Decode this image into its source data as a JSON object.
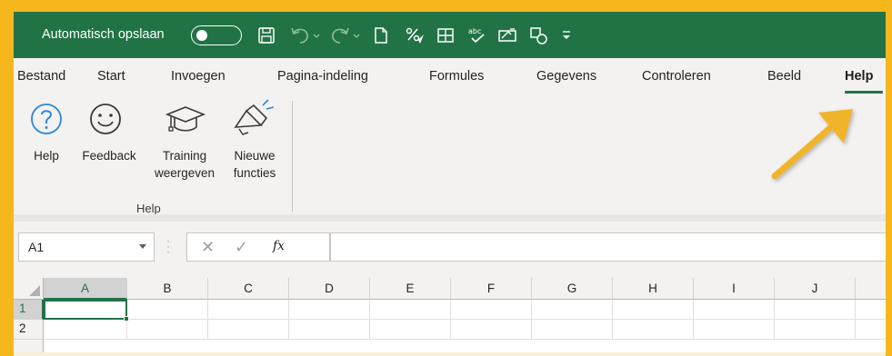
{
  "titlebar": {
    "autosave_label": "Automatisch opslaan",
    "autosave_state": "off",
    "quick_access_icons": [
      "save-icon",
      "undo-icon",
      "redo-icon",
      "new-document-icon",
      "percent-format-icon",
      "table-icon",
      "spelling-icon",
      "data-validation-icon",
      "shapes-icon",
      "customize-menu-icon"
    ]
  },
  "ribbon_tabs": [
    "Bestand",
    "Start",
    "Invoegen",
    "Pagina-indeling",
    "Formules",
    "Gegevens",
    "Controleren",
    "Beeld",
    "Help"
  ],
  "active_tab": "Help",
  "help_group": {
    "label": "Help",
    "buttons": [
      {
        "line1": "Help",
        "line2": "",
        "icon": "question-icon"
      },
      {
        "line1": "Feedback",
        "line2": "",
        "icon": "smiley-icon"
      },
      {
        "line1": "Training",
        "line2": "weergeven",
        "icon": "graduation-cap-icon"
      },
      {
        "line1": "Nieuwe",
        "line2": "functies",
        "icon": "megaphone-icon"
      }
    ]
  },
  "formula_bar": {
    "name_box": "A1",
    "fx_label": "fx",
    "formula": ""
  },
  "grid": {
    "columns": [
      "A",
      "B",
      "C",
      "D",
      "E",
      "F",
      "G",
      "H",
      "I",
      "J"
    ],
    "rows": [
      "1",
      "2"
    ],
    "selected_cell": "A1"
  },
  "colors": {
    "excel_green": "#217346",
    "frame_yellow": "#f5b71b",
    "arrow_yellow": "#f0b429"
  }
}
